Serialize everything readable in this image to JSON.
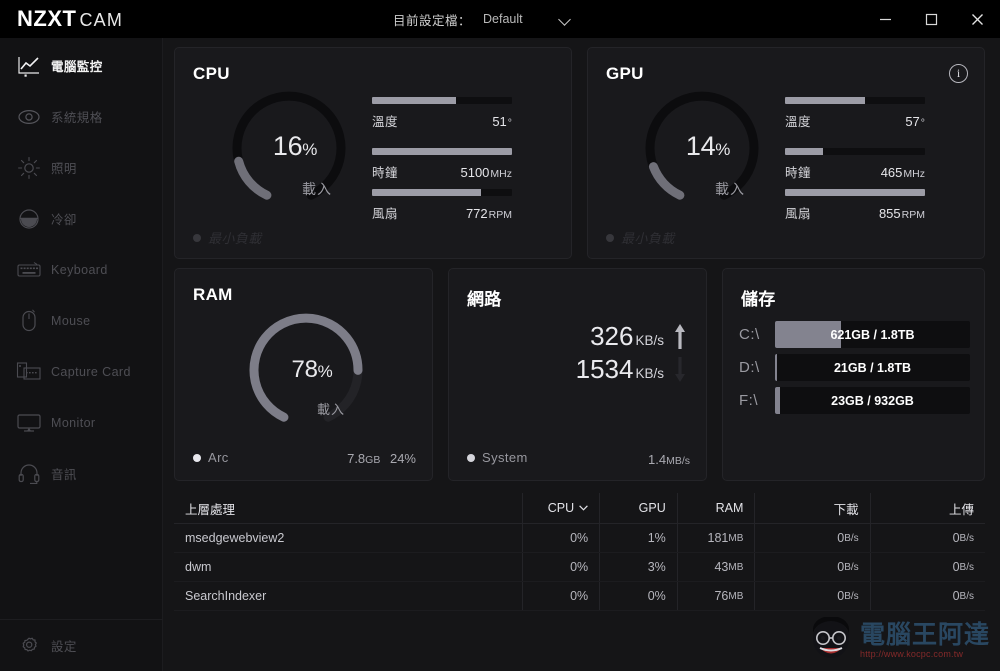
{
  "window": {
    "brand_primary": "NZXT",
    "brand_secondary": "CAM",
    "profile_label": "目前設定檔：",
    "profile_value": "Default",
    "minimize": "minimize-icon",
    "maximize": "maximize-icon",
    "close": "close-icon"
  },
  "sidebar": {
    "items": [
      {
        "label": "電腦監控",
        "icon": "chart-line-icon",
        "active": true
      },
      {
        "label": "系統規格",
        "icon": "eye-icon",
        "active": false
      },
      {
        "label": "照明",
        "icon": "sun-icon",
        "active": false
      },
      {
        "label": "冷卻",
        "icon": "fan-circle-icon",
        "active": false
      },
      {
        "label": "Keyboard",
        "icon": "keyboard-icon",
        "active": false
      },
      {
        "label": "Mouse",
        "icon": "mouse-icon",
        "active": false
      },
      {
        "label": "Capture Card",
        "icon": "capture-card-icon",
        "active": false
      },
      {
        "label": "Monitor",
        "icon": "monitor-icon",
        "active": false
      },
      {
        "label": "音訊",
        "icon": "headset-icon",
        "active": false
      }
    ],
    "settings": {
      "label": "設定",
      "icon": "gear-icon"
    }
  },
  "cpu": {
    "title": "CPU",
    "load_percent": "16",
    "load_unit": "%",
    "load_label": "載入",
    "load_fraction": 0.16,
    "metrics": [
      {
        "label": "溫度",
        "value": "51",
        "unit": "°",
        "fill": 0.6
      },
      {
        "label": "時鐘",
        "value": "5100",
        "unit": "MHz",
        "fill": 1.0
      },
      {
        "label": "風扇",
        "value": "772",
        "unit": "RPM",
        "fill": 0.78
      }
    ],
    "footer_process": "最小負載"
  },
  "gpu": {
    "title": "GPU",
    "info_icon": "info-icon",
    "load_percent": "14",
    "load_unit": "%",
    "load_label": "載入",
    "load_fraction": 0.14,
    "metrics": [
      {
        "label": "溫度",
        "value": "57",
        "unit": "°",
        "fill": 0.57
      },
      {
        "label": "時鐘",
        "value": "465",
        "unit": "MHz",
        "fill": 0.27
      },
      {
        "label": "風扇",
        "value": "855",
        "unit": "RPM",
        "fill": 1.0
      }
    ],
    "footer_process": "最小負載"
  },
  "ram": {
    "title": "RAM",
    "load_percent": "78",
    "load_unit": "%",
    "load_label": "載入",
    "load_fraction": 0.78,
    "top_process": "Arc",
    "used": "7.8",
    "used_unit": "GB",
    "process_percent": "24%"
  },
  "network": {
    "title": "網路",
    "up_value": "326",
    "up_unit": "KB/s",
    "down_value": "1534",
    "down_unit": "KB/s",
    "top_process": "System",
    "process_rate": "1.4",
    "process_rate_unit": "MB/s"
  },
  "storage": {
    "title": "儲存",
    "drives": [
      {
        "name": "C:\\",
        "text": "621GB / 1.8TB",
        "fill": 0.34
      },
      {
        "name": "D:\\",
        "text": "21GB / 1.8TB",
        "fill": 0.012
      },
      {
        "name": "F:\\",
        "text": "23GB / 932GB",
        "fill": 0.025
      }
    ]
  },
  "processes": {
    "columns": [
      {
        "key": "name",
        "label": "上層處理",
        "sorted": false
      },
      {
        "key": "cpu",
        "label": "CPU",
        "sorted": true
      },
      {
        "key": "gpu",
        "label": "GPU",
        "sorted": false
      },
      {
        "key": "ram",
        "label": "RAM",
        "sorted": false
      },
      {
        "key": "down",
        "label": "下載",
        "sorted": false
      },
      {
        "key": "up",
        "label": "上傳",
        "sorted": false
      }
    ],
    "rows": [
      {
        "name": "msedgewebview2",
        "cpu": "0%",
        "gpu": "1%",
        "ram_value": "181",
        "ram_unit": "MB",
        "down_value": "0",
        "down_unit": "B/s",
        "up_value": "0",
        "up_unit": "B/s"
      },
      {
        "name": "dwm",
        "cpu": "0%",
        "gpu": "3%",
        "ram_value": "43",
        "ram_unit": "MB",
        "down_value": "0",
        "down_unit": "B/s",
        "up_value": "0",
        "up_unit": "B/s"
      },
      {
        "name": "SearchIndexer",
        "cpu": "0%",
        "gpu": "0%",
        "ram_value": "76",
        "ram_unit": "MB",
        "down_value": "0",
        "down_unit": "B/s",
        "up_value": "0",
        "up_unit": "B/s"
      }
    ]
  },
  "watermark": {
    "text": "電腦王阿達",
    "url": "http://www.kocpc.com.tw"
  },
  "colors": {
    "accent_bar": "#9c9ca6",
    "panel": "#19191c",
    "background": "#151517",
    "sidebar": "#121214"
  }
}
